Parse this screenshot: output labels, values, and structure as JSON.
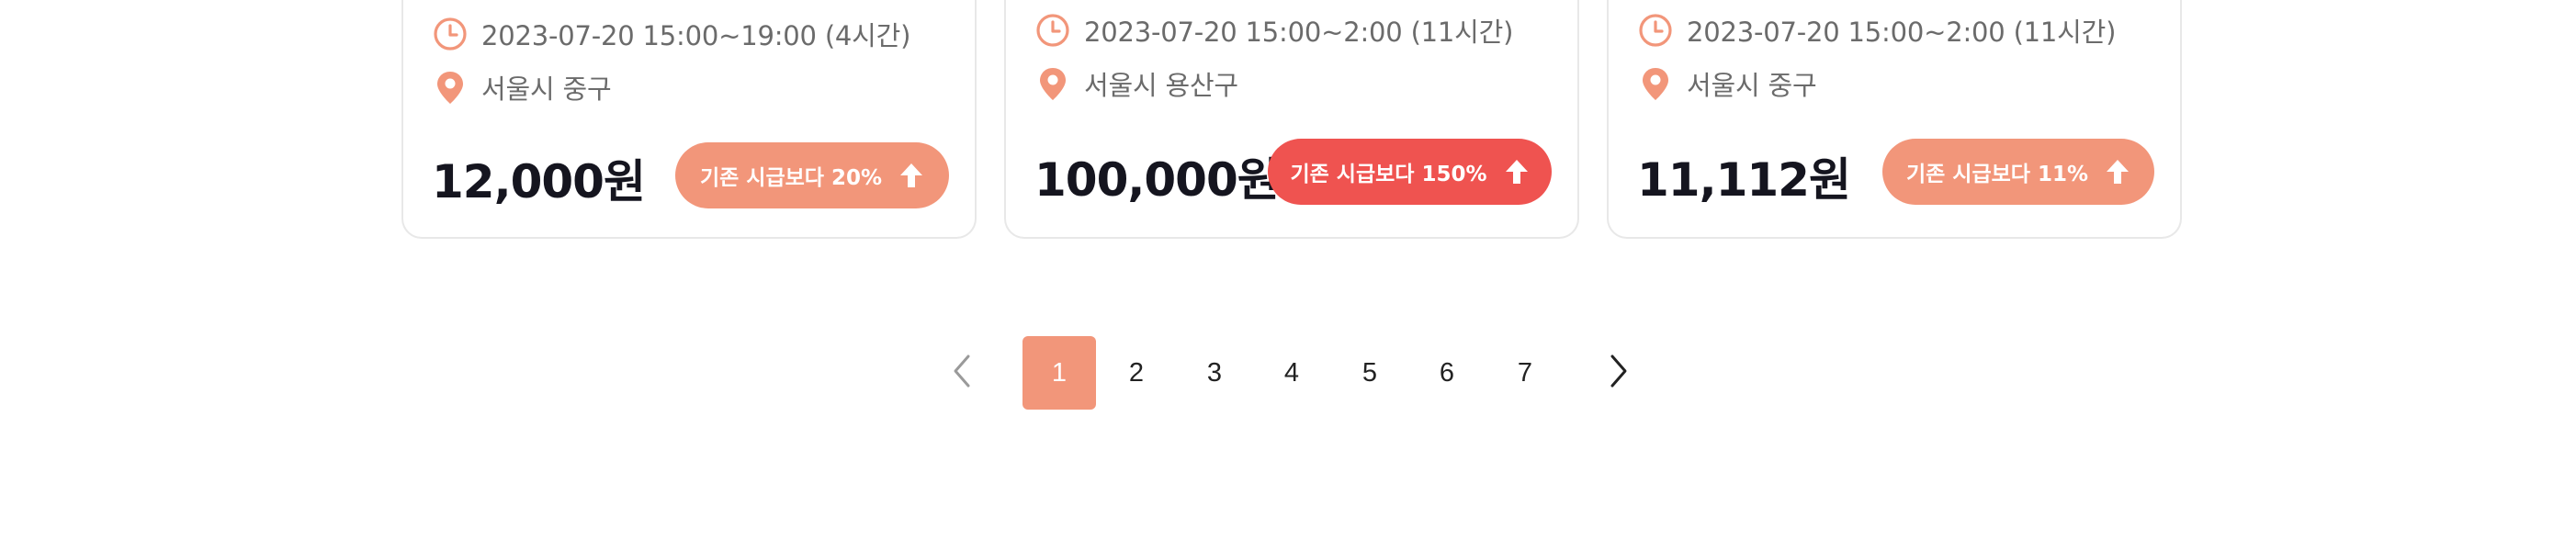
{
  "cards": [
    {
      "time": "2023-07-20 15:00~19:00 (4시간)",
      "location": "서울시 중구",
      "price": "12,000원",
      "badge": "기존 시급보다 20%",
      "badge_color": "#f2967a"
    },
    {
      "time": "2023-07-20 15:00~2:00 (11시간)",
      "location": "서울시 용산구",
      "price": "100,000원",
      "badge": "기존 시급보다 150%",
      "badge_color": "#ef5350"
    },
    {
      "time": "2023-07-20 15:00~2:00 (11시간)",
      "location": "서울시 중구",
      "price": "11,112원",
      "badge": "기존 시급보다 11%",
      "badge_color": "#f2967a"
    }
  ],
  "icons": {
    "time": "clock-icon",
    "location": "map-pin-icon",
    "badge": "arrow-up-icon",
    "prev": "chevron-left-icon",
    "next": "chevron-right-icon"
  },
  "pagination": {
    "pages": [
      "1",
      "2",
      "3",
      "4",
      "5",
      "6",
      "7"
    ],
    "current": "1"
  },
  "colors": {
    "accent": "#f2967a",
    "hot": "#ef5350",
    "text_dark": "#15151f",
    "text_muted": "#6b6b6b"
  }
}
